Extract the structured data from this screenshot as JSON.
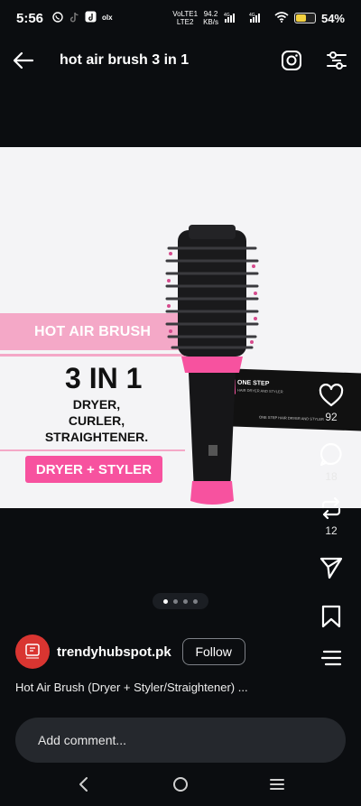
{
  "status_bar": {
    "time": "5:56",
    "left_icons": [
      "whatsapp-icon",
      "tiktok-icon",
      "tiktok-icon",
      "music-icon",
      "olx-icon"
    ],
    "network": {
      "carrier_top": "VoLTE1",
      "carrier_bottom": "LTE2",
      "speed_top": "94.2",
      "speed_bottom": "KB/s",
      "gen1": "4G",
      "gen2": "4G"
    },
    "battery_pct": "54%",
    "battery_level": 0.54
  },
  "app_bar": {
    "title": "hot air brush 3 in 1"
  },
  "post": {
    "image": {
      "banner": "HOT AIR BRUSH",
      "big_title": "3 IN 1",
      "features": [
        "DRYER,",
        "CURLER,",
        "STRAIGHTENER."
      ],
      "pill": "DRYER + STYLER",
      "box_line1": "ONE STEP",
      "box_line2": "HAIR DRYER AND STYLER",
      "box_line3": "ONE STEP HAIR DRYER AND STYLER"
    },
    "carousel": {
      "total": 4,
      "active": 1
    },
    "actions": {
      "likes": "92",
      "comments": "18",
      "reposts": "12"
    },
    "author": "trendyhubspot.pk",
    "follow_label": "Follow",
    "caption": "Hot Air Brush (Dryer + Styler/Straightener) ..."
  },
  "comment": {
    "placeholder": "Add comment..."
  },
  "colors": {
    "background": "#0b0d10",
    "accent_pink": "#f7529f",
    "banner_pink": "#f4a8c7",
    "avatar_red": "#d93531"
  }
}
